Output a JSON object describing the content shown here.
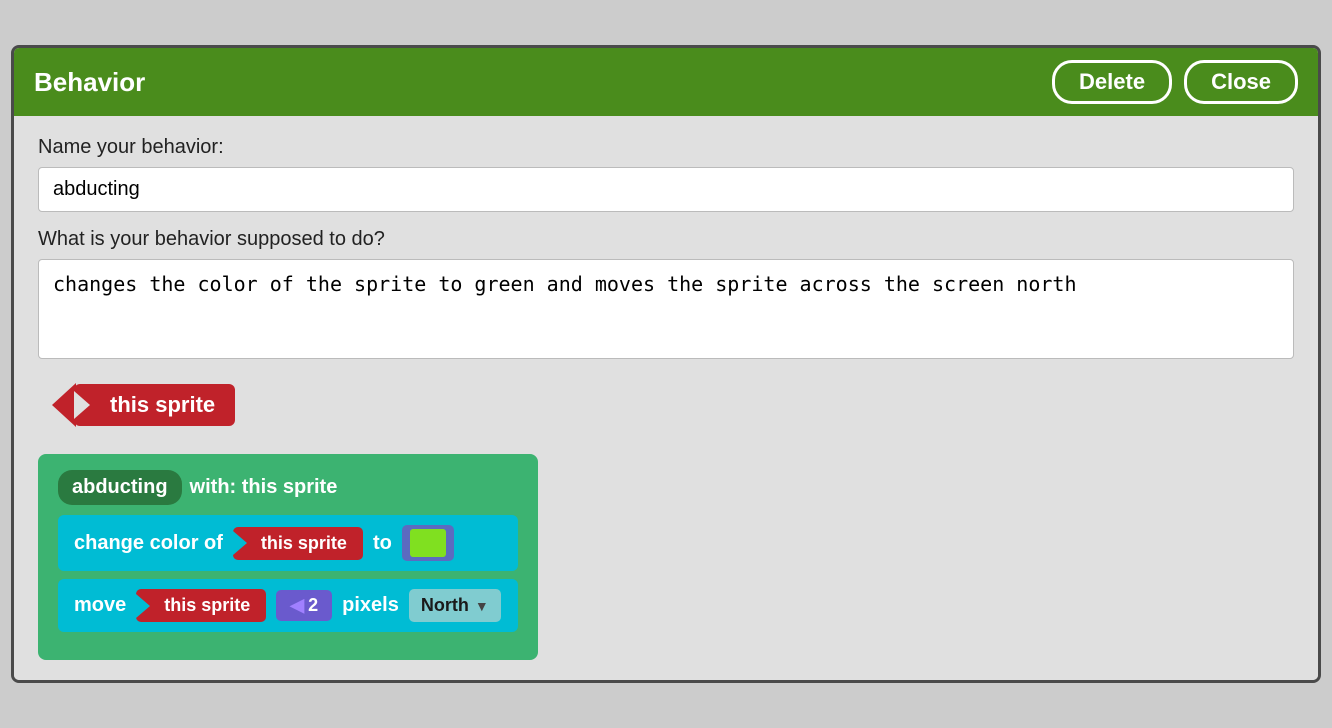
{
  "header": {
    "title": "Behavior",
    "delete_label": "Delete",
    "close_label": "Close"
  },
  "form": {
    "name_label": "Name your behavior:",
    "name_value": "abducting",
    "description_label": "What is your behavior supposed to do?",
    "description_value": "changes the color of the sprite to green and moves the sprite across the screen north"
  },
  "sprite_tag": {
    "label": "this sprite"
  },
  "blocks": {
    "header_name": "abducting",
    "header_with": "with: this sprite",
    "block1": {
      "change_text": "change color of",
      "sprite_label": "this sprite",
      "to_text": "to",
      "color": "#80e020"
    },
    "block2": {
      "move_text": "move",
      "sprite_label": "this sprite",
      "pixels_text": "pixels",
      "number": "2",
      "direction": "North"
    }
  }
}
